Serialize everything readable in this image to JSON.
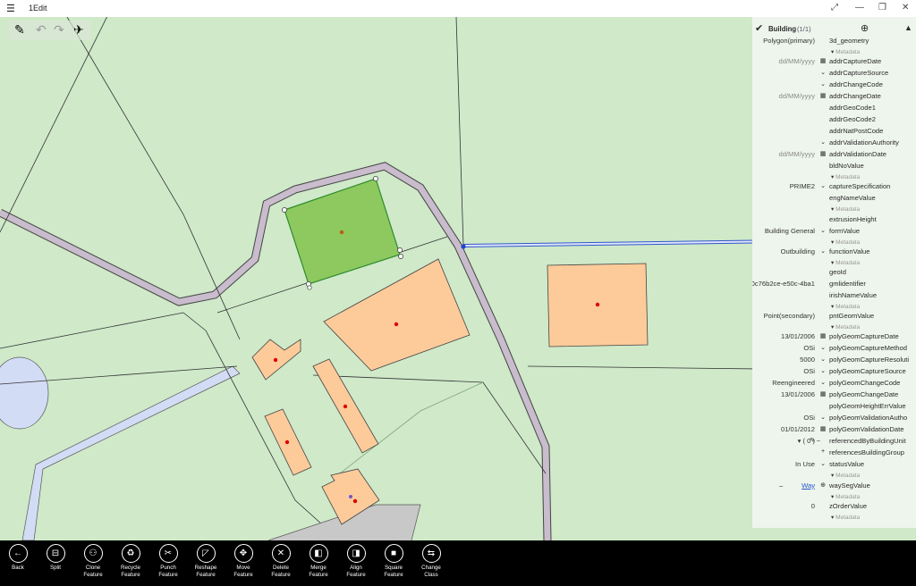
{
  "window": {
    "title": "1Edit",
    "menu_icon": "hamburger",
    "buttons": [
      "expand-icon",
      "minimize-icon",
      "restore-icon",
      "close-icon"
    ]
  },
  "panel": {
    "title": "Building",
    "count": "(1/1)",
    "rows": [
      {
        "value": "Polygon(primary)",
        "name": "3d_geometry"
      },
      {
        "meta": "Metadata"
      },
      {
        "value": "dd/MM/yyyy",
        "placeholder": true,
        "ctl": "cal",
        "name": "addrCaptureDate"
      },
      {
        "ctl": "dd",
        "name": "addrCaptureSource"
      },
      {
        "ctl": "dd",
        "name": "addrChangeCode"
      },
      {
        "value": "dd/MM/yyyy",
        "placeholder": true,
        "ctl": "cal",
        "name": "addrChangeDate"
      },
      {
        "name": "addrGeoCode1"
      },
      {
        "name": "addrGeoCode2"
      },
      {
        "name": "addrNatPostCode"
      },
      {
        "ctl": "dd",
        "name": "addrValidationAuthority"
      },
      {
        "value": "dd/MM/yyyy",
        "placeholder": true,
        "ctl": "cal",
        "name": "addrValidationDate"
      },
      {
        "name": "bldNoValue"
      },
      {
        "meta": "Metadata"
      },
      {
        "value": "PRIME2",
        "ctl": "dd",
        "name": "captureSpecification"
      },
      {
        "name": "engNameValue"
      },
      {
        "meta": "Metadata"
      },
      {
        "name": "extrusionHeight"
      },
      {
        "value": "Building General",
        "ctl": "dd",
        "name": "formValue"
      },
      {
        "meta": "Metadata"
      },
      {
        "value": "Outbuilding",
        "ctl": "dd",
        "name": "functionValue"
      },
      {
        "meta": "Metadata"
      },
      {
        "name": "geoId"
      },
      {
        "value": "0c76b2ce-e50c-4ba1",
        "name": "gmlidentifier"
      },
      {
        "name": "irishNameValue"
      },
      {
        "meta": "Metadata"
      },
      {
        "value": "Point(secondary)",
        "name": "pntGeomValue"
      },
      {
        "meta": "Metadata"
      },
      {
        "value": "13/01/2006",
        "ctl": "cal",
        "name": "polyGeomCaptureDate"
      },
      {
        "value": "OSi",
        "ctl": "dd",
        "name": "polyGeomCaptureMethod"
      },
      {
        "value": "5000",
        "ctl": "dd",
        "name": "polyGeomCaptureResoluti"
      },
      {
        "value": "OSi",
        "ctl": "dd",
        "name": "polyGeomCaptureSource"
      },
      {
        "value": "Reengineered",
        "ctl": "dd",
        "name": "polyGeomChangeCode"
      },
      {
        "value": "13/01/2006",
        "ctl": "cal",
        "name": "polyGeomChangeDate"
      },
      {
        "name": "polyGeomHeightErrValue"
      },
      {
        "value": "OSi",
        "ctl": "dd",
        "name": "polyGeomValidationAutho"
      },
      {
        "value": "01/01/2012",
        "ctl": "cal",
        "name": "polyGeomValidationDate"
      },
      {
        "value": "▾ ( 0 )",
        "ctl": "edit",
        "name": "referencedByBuildingUnit"
      },
      {
        "ctl": "+",
        "name": "referencesBuildingGroup"
      },
      {
        "value": "In Use",
        "ctl": "dd",
        "name": "statusValue"
      },
      {
        "meta": "Metadata"
      },
      {
        "value": "Way",
        "link": true,
        "ctl": "zoom",
        "name": "waySegValue"
      },
      {
        "meta": "Metadata"
      },
      {
        "value": "0",
        "name": "zOrderValue"
      },
      {
        "meta": "Metadata"
      }
    ]
  },
  "toolbar": [
    {
      "id": "back",
      "icon": "back-icon",
      "glyph": "←",
      "label": "Back"
    },
    {
      "id": "split",
      "icon": "split-icon",
      "glyph": "⊟",
      "label": "Split"
    },
    {
      "id": "clone",
      "icon": "clone-icon",
      "glyph": "⚇",
      "label": "Clone\nFeature"
    },
    {
      "id": "recycle",
      "icon": "recycle-icon",
      "glyph": "♻",
      "label": "Recycle\nFeature"
    },
    {
      "id": "punch",
      "icon": "scissors-icon",
      "glyph": "✂",
      "label": "Punch\nFeature"
    },
    {
      "id": "reshape",
      "icon": "reshape-icon",
      "glyph": "◸",
      "label": "Reshape\nFeature"
    },
    {
      "id": "move",
      "icon": "move-icon",
      "glyph": "✥",
      "label": "Move\nFeature"
    },
    {
      "id": "delete",
      "icon": "delete-icon",
      "glyph": "✕",
      "label": "Delete\nFeature"
    },
    {
      "id": "merge",
      "icon": "merge-icon",
      "glyph": "◧",
      "label": "Merge\nFeature"
    },
    {
      "id": "align",
      "icon": "align-icon",
      "glyph": "◨",
      "label": "Align\nFeature"
    },
    {
      "id": "square",
      "icon": "square-icon",
      "glyph": "■",
      "label": "Square\nFeature"
    },
    {
      "id": "change_class",
      "icon": "change-class-icon",
      "glyph": "⇆",
      "label": "Change\nClass"
    }
  ],
  "colors": {
    "map_bg": "#cfe9c9",
    "building_fill": "#fdcb9a",
    "selected_fill": "#8dc95f",
    "water": "#d3dcf5",
    "road": "#c9bccc",
    "toolbar": "#000000"
  }
}
